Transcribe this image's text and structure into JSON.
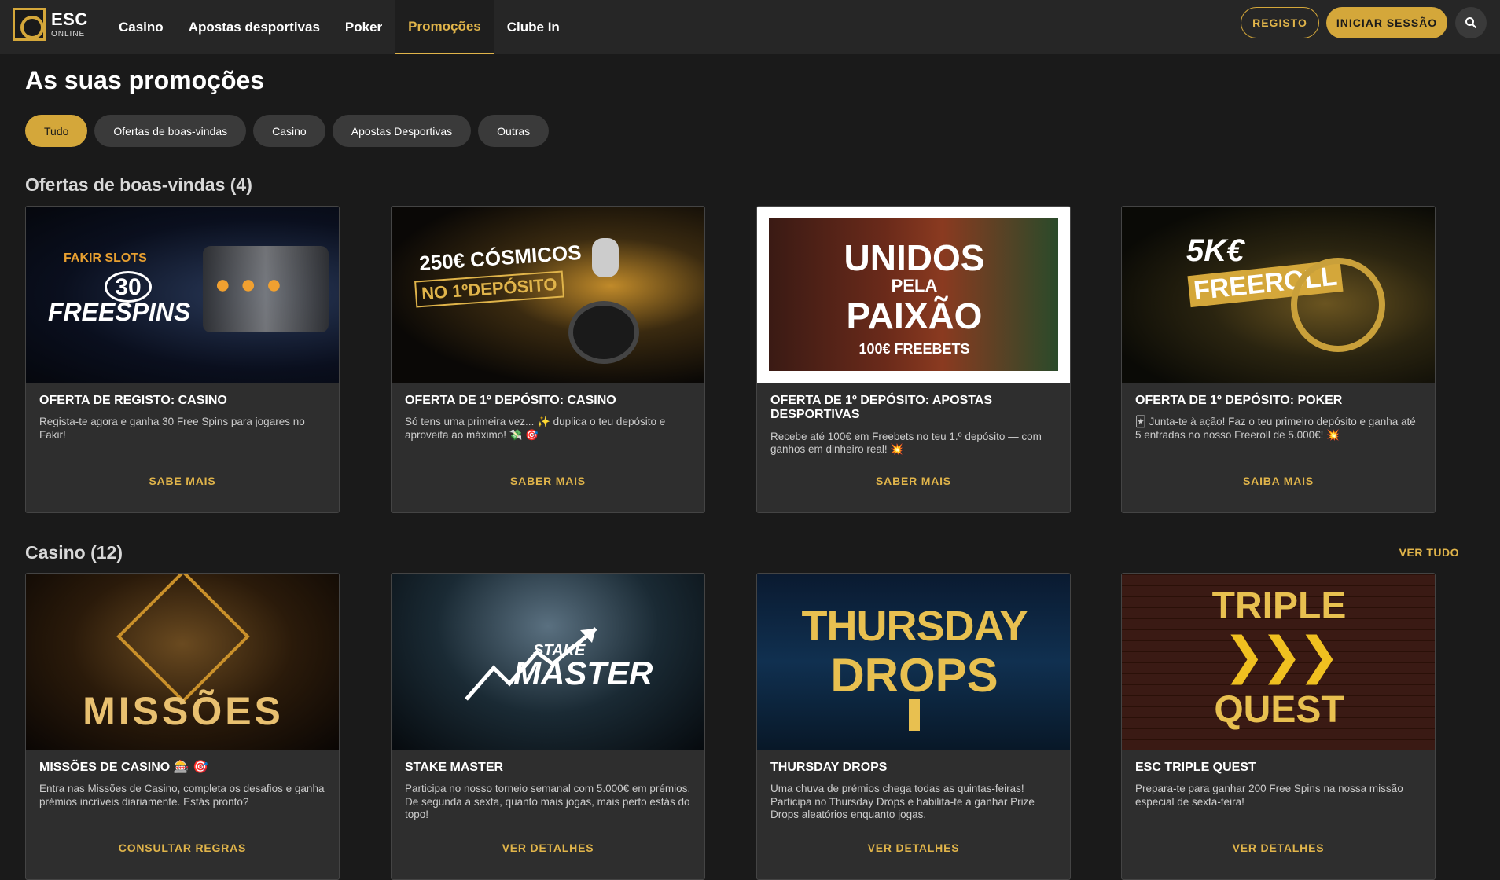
{
  "header": {
    "logo_big": "ESC",
    "logo_small": "ONLINE",
    "nav": [
      {
        "label": "Casino"
      },
      {
        "label": "Apostas desportivas"
      },
      {
        "label": "Poker"
      },
      {
        "label": "Promoções"
      },
      {
        "label": "Clube In"
      }
    ],
    "active_nav": "Promoções",
    "register_label": "REGISTO",
    "login_label": "INICIAR SESSÃO"
  },
  "page": {
    "title": "As suas promoções",
    "filters": [
      "Tudo",
      "Ofertas de boas-vindas",
      "Casino",
      "Apostas Desportivas",
      "Outras"
    ],
    "active_filter": "Tudo"
  },
  "sections": [
    {
      "title": "Ofertas de boas-vindas (4)",
      "see_all": "",
      "cards": [
        {
          "image_text": [
            "FAKIR SLOTS",
            "30",
            "FREESPINS"
          ],
          "title": "OFERTA DE REGISTO: CASINO",
          "description": "Regista-te agora e ganha 30 Free Spins para jogares no Fakir!",
          "cta": "SABE MAIS"
        },
        {
          "image_text": [
            "250€ CÓSMICOS",
            "NO 1ºDEPÓSITO"
          ],
          "title": "OFERTA DE 1º DEPÓSITO: CASINO",
          "description": "Só tens uma primeira vez... ✨ duplica o teu depósito e aproveita ao máximo! 💸 🎯",
          "cta": "SABER MAIS"
        },
        {
          "image_text": [
            "UNIDOS",
            "PELA",
            "PAIXÃO",
            "100€ FREEBETS"
          ],
          "title": "OFERTA DE 1º DEPÓSITO: APOSTAS DESPORTIVAS",
          "description": "Recebe até 100€ em Freebets no teu 1.º depósito — com ganhos em dinheiro real! 💥",
          "cta": "SABER MAIS"
        },
        {
          "image_text": [
            "5K€",
            "FREEROLL"
          ],
          "title": "OFERTA DE 1º DEPÓSITO: POKER",
          "description": "🃏 Junta-te à ação! Faz o teu primeiro depósito e ganha até 5 entradas no nosso Freeroll de 5.000€! 💥",
          "cta": "SAIBA MAIS"
        }
      ]
    },
    {
      "title": "Casino (12)",
      "see_all": "VER TUDO",
      "cards": [
        {
          "image_text": [
            "MISSÕES"
          ],
          "title": "MISSÕES DE CASINO 🎰 🎯",
          "description": "Entra nas Missões de Casino, completa os desafios e ganha prémios incríveis diariamente. Estás pronto?",
          "cta": "CONSULTAR REGRAS"
        },
        {
          "image_text": [
            "STAKE",
            "MASTER"
          ],
          "title": "STAKE MASTER",
          "description": "Participa no nosso torneio semanal com 5.000€ em prémios. De segunda a sexta, quanto mais jogas, mais perto estás do topo!",
          "cta": "VER DETALHES"
        },
        {
          "image_text": [
            "THURSDAY",
            "DROPS"
          ],
          "title": "THURSDAY DROPS",
          "description": "Uma chuva de prémios chega todas as quintas-feiras! Participa no Thursday Drops e habilita-te a ganhar Prize Drops aleatórios enquanto jogas.",
          "cta": "VER DETALHES"
        },
        {
          "image_text": [
            "TRIPLE",
            "QUEST"
          ],
          "title": "ESC TRIPLE QUEST",
          "description": "Prepara-te para ganhar 200 Free Spins na nossa missão especial de sexta-feira!",
          "cta": "VER DETALHES"
        }
      ]
    }
  ]
}
